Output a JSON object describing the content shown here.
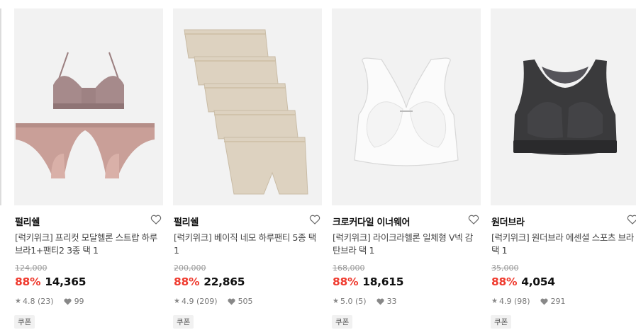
{
  "products": [
    {
      "brand": "펄리쉘",
      "title": "[럭키위크] 프리컷 모달헬론 스트랍 하루브라1+팬티2 3종 택 1",
      "original_price": "124,000",
      "discount": "88%",
      "price": "14,365",
      "rating": "4.8",
      "reviews": "(23)",
      "likes": "99",
      "coupon": "쿠폰",
      "image_icon": "bra-and-panties-set"
    },
    {
      "brand": "펄리쉘",
      "title": "[럭키위크] 베이직 네모 하루팬티 5종 택 1",
      "original_price": "200,000",
      "discount": "88%",
      "price": "22,865",
      "rating": "4.9",
      "reviews": "(209)",
      "likes": "505",
      "coupon": "쿠폰",
      "image_icon": "boxer-briefs-stack"
    },
    {
      "brand": "크로커다일 이너웨어",
      "title": "[럭키위크] 라이크라헬론 일체형 V넥 감탄브라 택 1",
      "original_price": "168,000",
      "discount": "88%",
      "price": "18,615",
      "rating": "5.0",
      "reviews": "(5)",
      "likes": "33",
      "coupon": "쿠폰",
      "image_icon": "white-seamless-bra"
    },
    {
      "brand": "원더브라",
      "title": "[럭키위크] 원더브라 에센셜 스포츠 브라 택 1",
      "original_price": "35,000",
      "discount": "88%",
      "price": "4,054",
      "rating": "4.9",
      "reviews": "(98)",
      "likes": "291",
      "coupon": "쿠폰",
      "image_icon": "black-sports-bra"
    }
  ],
  "colors": {
    "discount": "#ef3a2e",
    "thumb_bg": "#f2f2f2"
  }
}
